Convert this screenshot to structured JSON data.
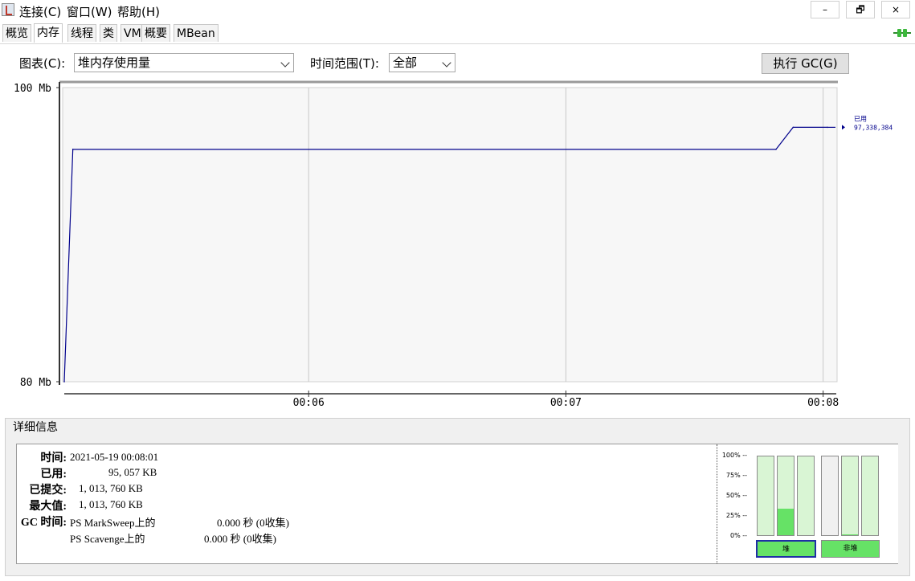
{
  "menu": {
    "connect": "连接(C)",
    "window": "窗口(W)",
    "help": "帮助(H)",
    "minimize": "–",
    "restore": "🗗",
    "close": "×"
  },
  "tabs": [
    "概览",
    "内存",
    "线程",
    "类",
    "VM",
    "概要",
    "MBean"
  ],
  "controls": {
    "chart_label": "图表(C):",
    "chart_value": "堆内存使用量",
    "range_label": "时间范围(T):",
    "range_value": "全部",
    "gc_button": "执行 GC(G)"
  },
  "chart_data": {
    "type": "line",
    "ylim": [
      80,
      100
    ],
    "ytick_labels": [
      "100 Mb",
      "80 Mb"
    ],
    "xtick_labels": [
      "00:06",
      "00:07",
      "00:08"
    ],
    "series": [
      {
        "name": "已用",
        "color": "#00008b",
        "last_value_label": "97,338,384",
        "points": [
          {
            "x": "00:05:03",
            "y": 80.0
          },
          {
            "x": "00:05:05",
            "y": 95.8
          },
          {
            "x": "00:07:49",
            "y": 95.8
          },
          {
            "x": "00:07:53",
            "y": 97.3
          },
          {
            "x": "00:08:01",
            "y": 97.3
          }
        ]
      }
    ]
  },
  "details": {
    "title": "详细信息",
    "time_label": "时间:",
    "time_value": "2021-05-19 00:08:01",
    "used_label": "已用:",
    "used_value": "95, 057 KB",
    "committed_label": "已提交:",
    "committed_value": "1, 013, 760 KB",
    "max_label": "最大值:",
    "max_value": "1, 013, 760 KB",
    "gc_label": "GC 时间:",
    "gc_rows": [
      {
        "name": "PS MarkSweep上的",
        "value": "0.000 秒 (0收集)"
      },
      {
        "name": "PS Scavenge上的",
        "value": "0.000 秒 (0收集)"
      }
    ]
  },
  "pools": {
    "pct_labels": [
      "100% --",
      "75% --",
      "50% --",
      "25% --",
      "0% --"
    ],
    "heap_fill": [
      0.0,
      0.34,
      0.0
    ],
    "nonheap_fill": [
      0.0,
      0.01,
      0.0
    ],
    "heap_label": "堆",
    "nonheap_label": "非堆"
  }
}
